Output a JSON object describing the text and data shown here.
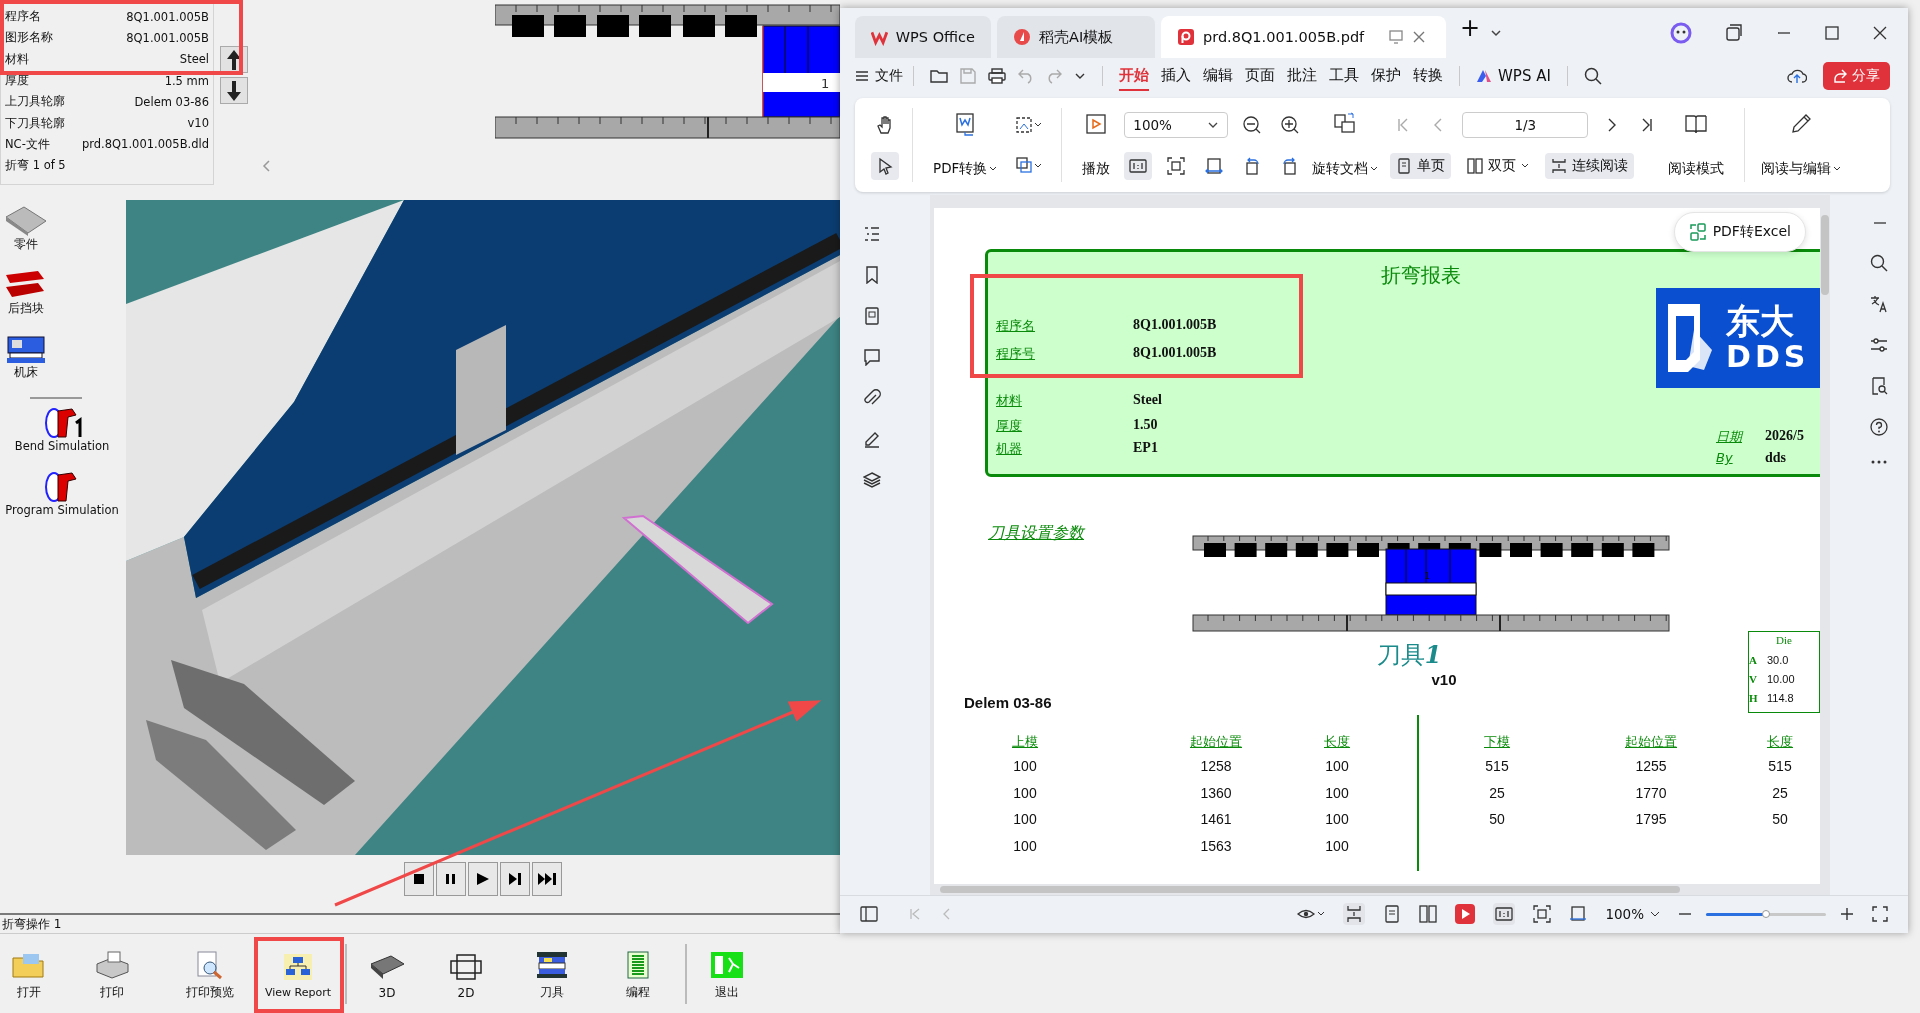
{
  "cad_app": {
    "info_rows": [
      {
        "label": "程序名",
        "value": "8Q1.001.005B"
      },
      {
        "label": "图形名称",
        "value": "8Q1.001.005B"
      },
      {
        "label": "材料",
        "value": "Steel"
      },
      {
        "label": "厚度",
        "value": "1.5 mm"
      },
      {
        "label": "上刀具轮廓",
        "value": "Delem 03-86"
      },
      {
        "label": "下刀具轮廓",
        "value": "v10"
      },
      {
        "label": "NC-文件",
        "value": "prd.8Q1.001.005B.dld"
      }
    ],
    "bend_counter": "折弯 1 of 5",
    "tool_label": "1",
    "sidebar": [
      {
        "kind": "part",
        "label": "零件"
      },
      {
        "kind": "backgauge",
        "label": "后挡块"
      },
      {
        "kind": "machine",
        "label": "机床"
      },
      {
        "kind": "bend_sim",
        "label": "Bend Simulation"
      },
      {
        "kind": "prog_sim",
        "label": "Program Simulation"
      }
    ],
    "status_text": "折弯操作 1",
    "toolbar": [
      {
        "kind": "open",
        "label": "打开"
      },
      {
        "kind": "print",
        "label": "打印"
      },
      {
        "kind": "preview",
        "label": "打印预览"
      },
      {
        "kind": "report",
        "label": "View Report"
      },
      {
        "kind": "solid",
        "label": "3D"
      },
      {
        "kind": "flat",
        "label": "2D"
      },
      {
        "kind": "tools",
        "label": "刀具"
      },
      {
        "kind": "program",
        "label": "编程"
      },
      {
        "kind": "exit",
        "label": "退出"
      }
    ]
  },
  "wps": {
    "tabs": [
      {
        "kind": "wps",
        "label": "WPS Office",
        "selected": false
      },
      {
        "kind": "docer",
        "label": "稻壳AI模板",
        "selected": false
      },
      {
        "kind": "pdf",
        "label": "prd.8Q1.001.005B.pdf",
        "selected": true
      }
    ],
    "new_tab": "+",
    "file_menu": "文件",
    "menu_tabs": [
      {
        "label": "开始",
        "selected": true
      },
      {
        "label": "插入",
        "selected": false
      },
      {
        "label": "编辑",
        "selected": false
      },
      {
        "label": "页面",
        "selected": false
      },
      {
        "label": "批注",
        "selected": false
      },
      {
        "label": "工具",
        "selected": false
      },
      {
        "label": "保护",
        "selected": false
      },
      {
        "label": "转换",
        "selected": false
      }
    ],
    "ai_label": "WPS AI",
    "share": "分享",
    "ribbon": {
      "pdf_convert": "PDF转换",
      "play": "播放",
      "zoom": "100%",
      "rotate": "旋转文档",
      "page": "1/3",
      "views": [
        {
          "kind": "single",
          "label": "单页",
          "selected": true
        },
        {
          "kind": "double",
          "label": "双页",
          "selected": false
        },
        {
          "kind": "continuous",
          "label": "连续阅读",
          "selected": true
        }
      ],
      "read_mode": "阅读模式",
      "read_edit": "阅读与编辑"
    },
    "pdf_to_excel": "PDF转Excel",
    "report": {
      "title": "折弯报表",
      "fields": [
        {
          "label": "程序名",
          "value": "8Q1.001.005B"
        },
        {
          "label": "程序号",
          "value": "8Q1.001.005B"
        },
        {
          "label": "材料",
          "value": "Steel"
        },
        {
          "label": "厚度",
          "value": "1.50"
        },
        {
          "label": "机器",
          "value": "EP1"
        }
      ],
      "logo_cn": "东大",
      "logo_en": "DDS",
      "meta": [
        {
          "label": "日期",
          "value": "2026/5"
        },
        {
          "label": "By",
          "value": "dds"
        }
      ],
      "tool_section": "刀具设置参数",
      "tool_number": "1",
      "tool_title": "刀具",
      "tool_index": "1",
      "die_name": "v10",
      "punch_name": "Delem 03-86",
      "die": {
        "title": "Die",
        "rows": [
          {
            "label": "A",
            "value": "30.0"
          },
          {
            "label": "V",
            "value": "10.00"
          },
          {
            "label": "H",
            "value": "114.8"
          }
        ]
      },
      "upper": {
        "columns": [
          "上模",
          "起始位置",
          "长度"
        ],
        "rows": [
          [
            "100",
            "1258",
            "100"
          ],
          [
            "100",
            "1360",
            "100"
          ],
          [
            "100",
            "1461",
            "100"
          ],
          [
            "100",
            "1563",
            "100"
          ]
        ]
      },
      "lower": {
        "columns": [
          "下模",
          "起始位置",
          "长度"
        ],
        "rows": [
          [
            "515",
            "1255",
            "515"
          ],
          [
            "25",
            "1770",
            "25"
          ],
          [
            "50",
            "1795",
            "50"
          ]
        ]
      }
    },
    "status_bar": {
      "zoom": "100%",
      "level": 0.5
    }
  }
}
